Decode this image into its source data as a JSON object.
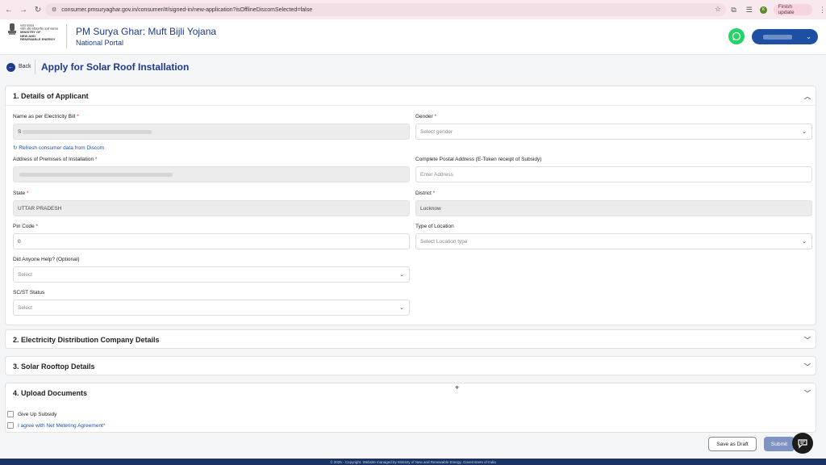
{
  "browser": {
    "url": "consumer.pmsuryaghar.gov.in/consumer/#/signed-in/new-application?isOfflineDiscomSelected=false",
    "profile_initial": "K",
    "finish_update_label": "Finish update"
  },
  "header": {
    "ministry_lines": [
      "भारत सरकार",
      "नवीन और नवीकरणीय ऊर्जा मंत्रालय",
      "MINISTRY OF",
      "NEW AND",
      "RENEWABLE ENERGY"
    ],
    "title": "PM Surya Ghar: Muft Bijli Yojana",
    "subtitle": "National Portal"
  },
  "page": {
    "back_label": "Back",
    "title": "Apply for Solar Roof Installation"
  },
  "section1": {
    "title": "1. Details of Applicant",
    "name_label": "Name as per Electricity Bill",
    "name_value_prefix": "S",
    "refresh_label": "Refresh consumer data from Discom",
    "gender_label": "Gender",
    "gender_placeholder": "Select gender",
    "address_label": "Address of Premises of Installation",
    "postal_label": "Complete Postal Address (E-Token receipt of Subsidy)",
    "postal_placeholder": "Enter Address",
    "state_label": "State",
    "state_value": "UTTAR PRADESH",
    "district_label": "District",
    "district_value": "Lucknow",
    "pincode_label": "Pin Code",
    "pincode_value": "0",
    "location_label": "Type of Location",
    "location_placeholder": "Select Location type",
    "help_label": "Did Anyone Help? (Optional)",
    "help_placeholder": "Select",
    "scst_label": "SC/ST Status",
    "scst_placeholder": "Select"
  },
  "section2": {
    "title": "2. Electricity Distribution Company Details"
  },
  "section3": {
    "title": "3. Solar Rooftop Details"
  },
  "section4": {
    "title": "4. Upload Documents"
  },
  "checks": {
    "give_up_subsidy": "Give Up Subsidy",
    "net_metering": "I agree with Net Metering Agreement"
  },
  "actions": {
    "save_draft": "Save as Draft",
    "submit": "Submit"
  },
  "footer": {
    "text": "© 2025 - Copyright. Website managed by Ministry of New and Renewable Energy, Government of India"
  },
  "colors": {
    "brand": "#1e3a8a",
    "pill": "#1d4fa3",
    "whatsapp": "#25d366",
    "submit": "#7e93c4"
  }
}
